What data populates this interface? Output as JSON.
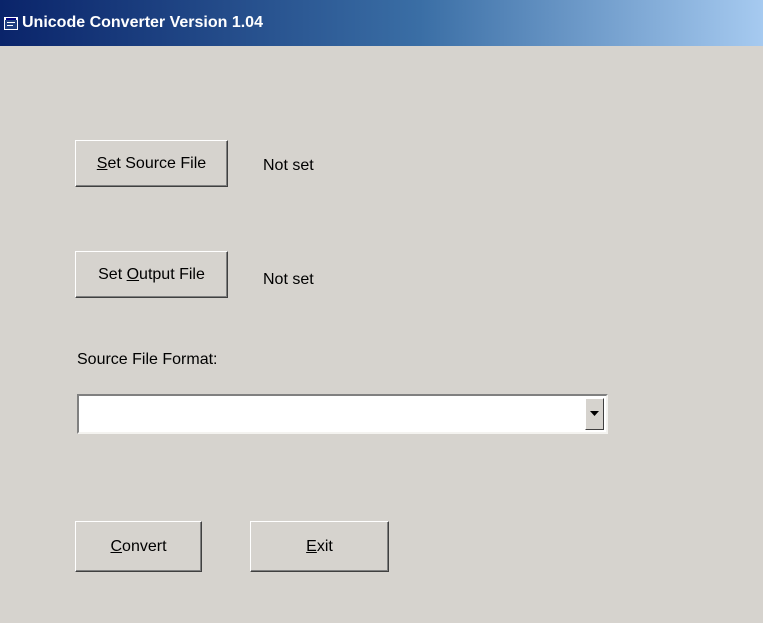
{
  "window": {
    "title": "Unicode Converter Version 1.04",
    "title_icon": "application-icon"
  },
  "source": {
    "button_prefix": "",
    "button_mnemonic": "S",
    "button_suffix": "et Source File",
    "status": "Not set"
  },
  "output": {
    "button_prefix": "Set ",
    "button_mnemonic": "O",
    "button_suffix": "utput File",
    "status": "Not set"
  },
  "format": {
    "label": "Source File Format:",
    "selected_value": "",
    "dropdown_icon": "chevron-down-icon"
  },
  "actions": {
    "convert_mnemonic": "C",
    "convert_suffix": "onvert",
    "exit_mnemonic": "E",
    "exit_suffix": "xit"
  },
  "colors": {
    "titlebar_start": "#0a246a",
    "titlebar_end": "#a6caf0",
    "face": "#d6d3ce"
  }
}
